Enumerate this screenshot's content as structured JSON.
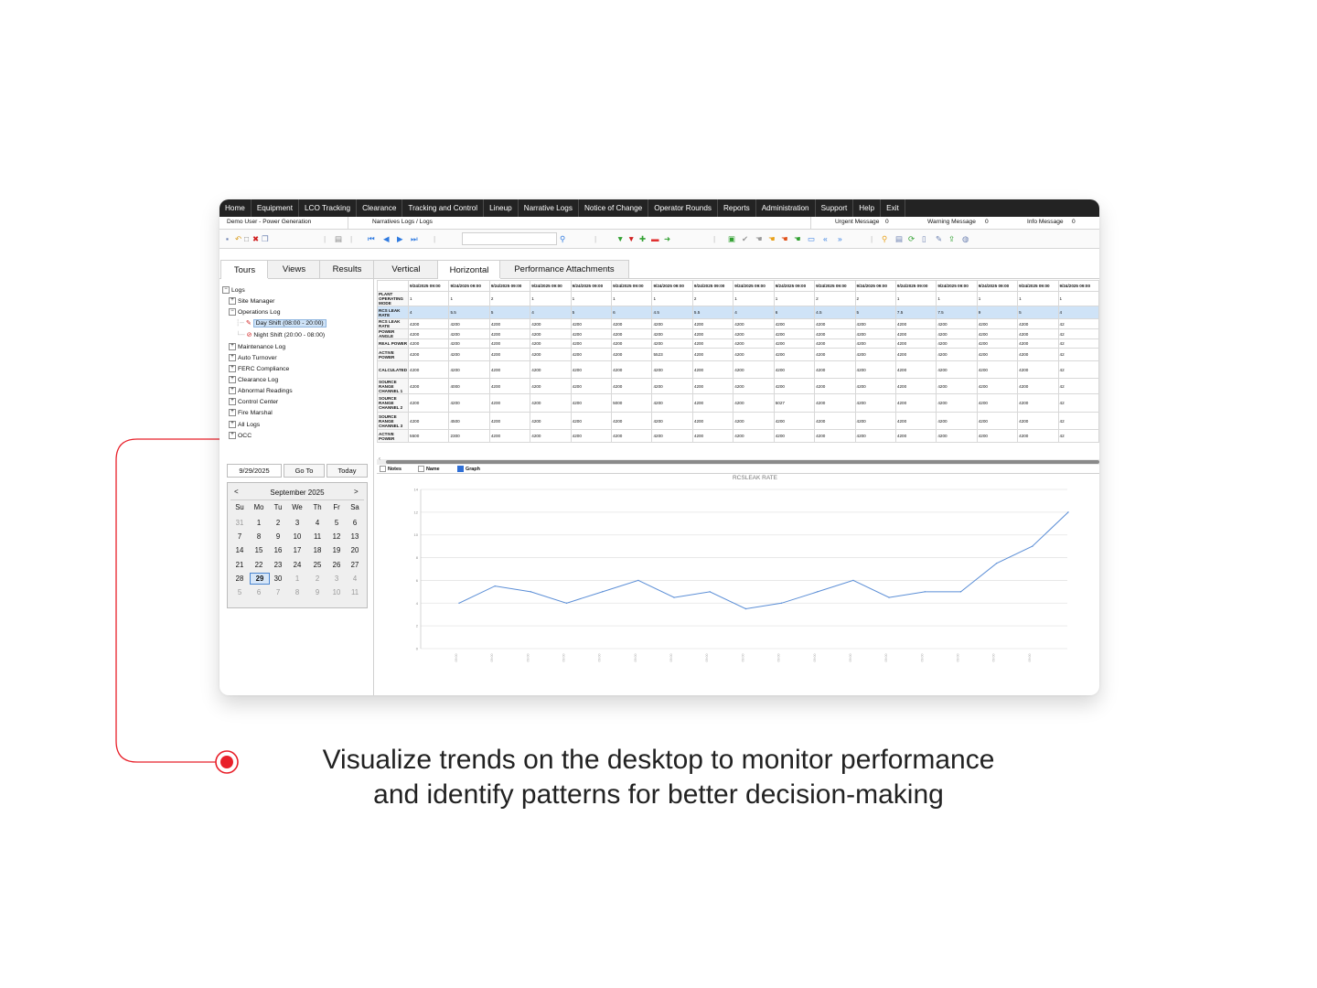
{
  "menu": [
    "Home",
    "Equipment",
    "LCO Tracking",
    "Clearance",
    "Tracking and Control",
    "Lineup",
    "Narrative Logs",
    "Notice of Change",
    "Operator Rounds",
    "Reports",
    "Administration",
    "Support",
    "Help",
    "Exit"
  ],
  "info": {
    "user": "Demo User - Power Generation",
    "breadcrumb": "Narratives Logs / Logs",
    "urgent_label": "Urgent Message",
    "urgent_count": "0",
    "warning_label": "Warning Message",
    "warning_count": "0",
    "info_label": "Info Message",
    "info_count": "0"
  },
  "tabs": [
    "Tours",
    "Views",
    "Results",
    "Vertical",
    "Horizontal",
    "Performance Attachments"
  ],
  "tree": {
    "root": "Logs",
    "items": [
      "Site Manager",
      "Operations Log",
      "Day Shift (08:00 - 20:00)",
      "Night Shift (20:00 - 08:00)",
      "Maintenance Log",
      "Auto Turnover",
      "FERC Compliance",
      "Clearance Log",
      "Abnormal Readings",
      "Control Center",
      "Fire Marshal",
      "All Logs",
      "OCC"
    ]
  },
  "date_controls": {
    "date": "9/29/2025",
    "goto": "Go To",
    "today": "Today"
  },
  "calendar": {
    "prev": "<",
    "next": ">",
    "month": "September 2025",
    "weekdays": [
      "Su",
      "Mo",
      "Tu",
      "We",
      "Th",
      "Fr",
      "Sa"
    ],
    "weeks": [
      [
        "31",
        "1",
        "2",
        "3",
        "4",
        "5",
        "6"
      ],
      [
        "7",
        "8",
        "9",
        "10",
        "11",
        "12",
        "13"
      ],
      [
        "14",
        "15",
        "16",
        "17",
        "18",
        "19",
        "20"
      ],
      [
        "21",
        "22",
        "23",
        "24",
        "25",
        "26",
        "27"
      ],
      [
        "28",
        "29",
        "30",
        "1",
        "2",
        "3",
        "4"
      ],
      [
        "5",
        "6",
        "7",
        "8",
        "9",
        "10",
        "11"
      ]
    ],
    "selected": "29"
  },
  "grid": {
    "headers": [
      "9/24/2025 09:00",
      "9/24/2025 09:00",
      "9/24/2025 09:00",
      "9/24/2025 09:00",
      "9/24/2025 09:00",
      "9/24/2025 09:00",
      "9/24/2025 09:00",
      "9/24/2025 09:00",
      "9/24/2025 09:00",
      "9/24/2025 09:00",
      "9/24/2025 09:00",
      "9/24/2025 09:00",
      "9/24/2025 09:00",
      "9/24/2025 09:00",
      "9/24/2025 09:00",
      "9/24/2025 09:00",
      "9/24/2025 09:00"
    ],
    "rows": [
      {
        "label": "PLANT OPERATING MODE",
        "values": [
          "1",
          "1",
          "2",
          "1",
          "1",
          "1",
          "1",
          "2",
          "1",
          "1",
          "2",
          "2",
          "1",
          "1",
          "1",
          "1",
          "1"
        ]
      },
      {
        "label": "RCS LEAK RATE",
        "values": [
          "4",
          "5.5",
          "5",
          "4",
          "5",
          "6",
          "4.5",
          "5.5",
          "4",
          "6",
          "4.5",
          "5",
          "7.5",
          "7.5",
          "9",
          "5",
          "4"
        ],
        "highlight": true
      },
      {
        "label": "RCS LEAK RATE",
        "values": [
          "4200",
          "4200",
          "4200",
          "4200",
          "4200",
          "4200",
          "4200",
          "4200",
          "4200",
          "4200",
          "4200",
          "4200",
          "4200",
          "4200",
          "4200",
          "4200",
          "42"
        ]
      },
      {
        "label": "POWER ANGLE",
        "values": [
          "4200",
          "4200",
          "4200",
          "4200",
          "4200",
          "4200",
          "4200",
          "4200",
          "4200",
          "4200",
          "4200",
          "4200",
          "4200",
          "4200",
          "4200",
          "4200",
          "42"
        ]
      },
      {
        "label": "REAL POWER",
        "values": [
          "4200",
          "4200",
          "4200",
          "4200",
          "4200",
          "4200",
          "4200",
          "4200",
          "4200",
          "4200",
          "4200",
          "4200",
          "4200",
          "4200",
          "4200",
          "4200",
          "42"
        ]
      },
      {
        "label": "ACTIVE POWER",
        "values": [
          "4200",
          "4200",
          "4200",
          "4200",
          "4200",
          "4200",
          "5523",
          "4200",
          "4200",
          "4200",
          "4200",
          "4200",
          "4200",
          "4200",
          "4200",
          "4200",
          "42"
        ]
      },
      {
        "label": "CALCULATED",
        "values": [
          "4200",
          "4200",
          "4200",
          "4200",
          "4200",
          "4200",
          "4200",
          "4200",
          "4200",
          "4200",
          "4200",
          "4200",
          "4200",
          "4200",
          "4200",
          "4200",
          "42"
        ]
      },
      {
        "label": "SOURCE RANGE CHANNEL 1",
        "values": [
          "4200",
          "4000",
          "4200",
          "4200",
          "4200",
          "4200",
          "4200",
          "4200",
          "4200",
          "4200",
          "4200",
          "4200",
          "4200",
          "4200",
          "4200",
          "4200",
          "42"
        ]
      },
      {
        "label": "SOURCE RANGE CHANNEL 2",
        "values": [
          "4200",
          "4200",
          "4200",
          "4200",
          "4200",
          "5000",
          "4200",
          "4200",
          "4200",
          "5027",
          "4200",
          "4200",
          "4200",
          "4200",
          "4200",
          "4200",
          "42"
        ]
      },
      {
        "label": "SOURCE RANGE CHANNEL 3",
        "values": [
          "4200",
          "4500",
          "4200",
          "4200",
          "4200",
          "4200",
          "4200",
          "4200",
          "4200",
          "4200",
          "4200",
          "4200",
          "4200",
          "4200",
          "4200",
          "4200",
          "42"
        ]
      },
      {
        "label": "ACTIVE POWER",
        "values": [
          "5500",
          "2300",
          "4200",
          "4200",
          "4200",
          "4200",
          "4200",
          "4200",
          "4200",
          "4200",
          "4200",
          "4200",
          "4200",
          "4200",
          "4200",
          "4200",
          "42"
        ]
      }
    ]
  },
  "chart_options": {
    "notes": "Notes",
    "name": "Name",
    "graph": "Graph"
  },
  "chart_data": {
    "type": "line",
    "title": "RCSLEAK RATE",
    "ylabel": "",
    "ylim": [
      0,
      14
    ],
    "yticks": [
      0,
      2,
      4,
      6,
      8,
      10,
      12,
      14
    ],
    "x": [
      "09:00",
      "09:00",
      "09:00",
      "09:00",
      "09:00",
      "09:00",
      "09:00",
      "09:00",
      "09:00",
      "09:00",
      "09:00",
      "09:00",
      "09:00",
      "09:00",
      "09:00",
      "09:00",
      "09:00"
    ],
    "series": [
      {
        "values": [
          4,
          5.5,
          5,
          4,
          5,
          6,
          4.5,
          5,
          3.5,
          4,
          5,
          6,
          4.5,
          5,
          5,
          7.5,
          9,
          12
        ],
        "color": "#5b8ed6"
      }
    ],
    "grid": true
  },
  "caption": {
    "line1": "Visualize trends on the desktop to monitor performance",
    "line2": "and identify patterns for better decision-making"
  },
  "colors": {
    "accent_red": "#e8202a",
    "line_blue": "#5b8ed6",
    "menubar": "#232323",
    "highlight": "#cfe3f7"
  }
}
